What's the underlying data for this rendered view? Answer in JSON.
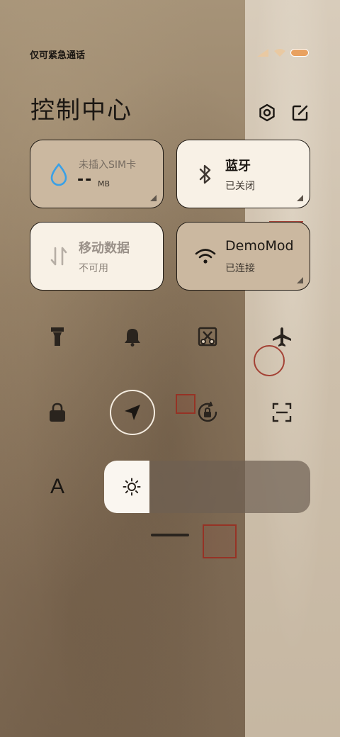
{
  "status_bar": {
    "carrier_text": "仅可紧急通话",
    "battery_color": "#e8a160"
  },
  "header": {
    "title": "控制中心",
    "settings_icon": "hexagon-settings-icon",
    "edit_icon": "edit-icon"
  },
  "tiles": [
    {
      "id": "data-usage",
      "label": "未插入SIM卡",
      "value": "--",
      "unit": "MB",
      "icon": "water-drop-icon"
    },
    {
      "id": "bluetooth",
      "label": "蓝牙",
      "status": "已关闭",
      "icon": "bluetooth-icon"
    },
    {
      "id": "mobile-data",
      "label": "移动数据",
      "status": "不可用",
      "icon": "data-arrows-icon"
    },
    {
      "id": "wifi",
      "label": "DemoMod",
      "status": "已连接",
      "icon": "wifi-icon"
    }
  ],
  "toggles": [
    "flashlight-icon",
    "bell-icon",
    "screenshot-scissors-icon",
    "airplane-icon",
    "lock-icon",
    "location-icon",
    "rotation-lock-icon",
    "scan-icon",
    "font-size-icon"
  ],
  "font_toggle": {
    "glyph": "A"
  },
  "brightness": {
    "level": 0.22,
    "icon": "sun-icon"
  },
  "colors": {
    "accent": "#3aa0e6",
    "tile_light": "#f8f1e6",
    "tile_tan": "#cbb8a0"
  }
}
